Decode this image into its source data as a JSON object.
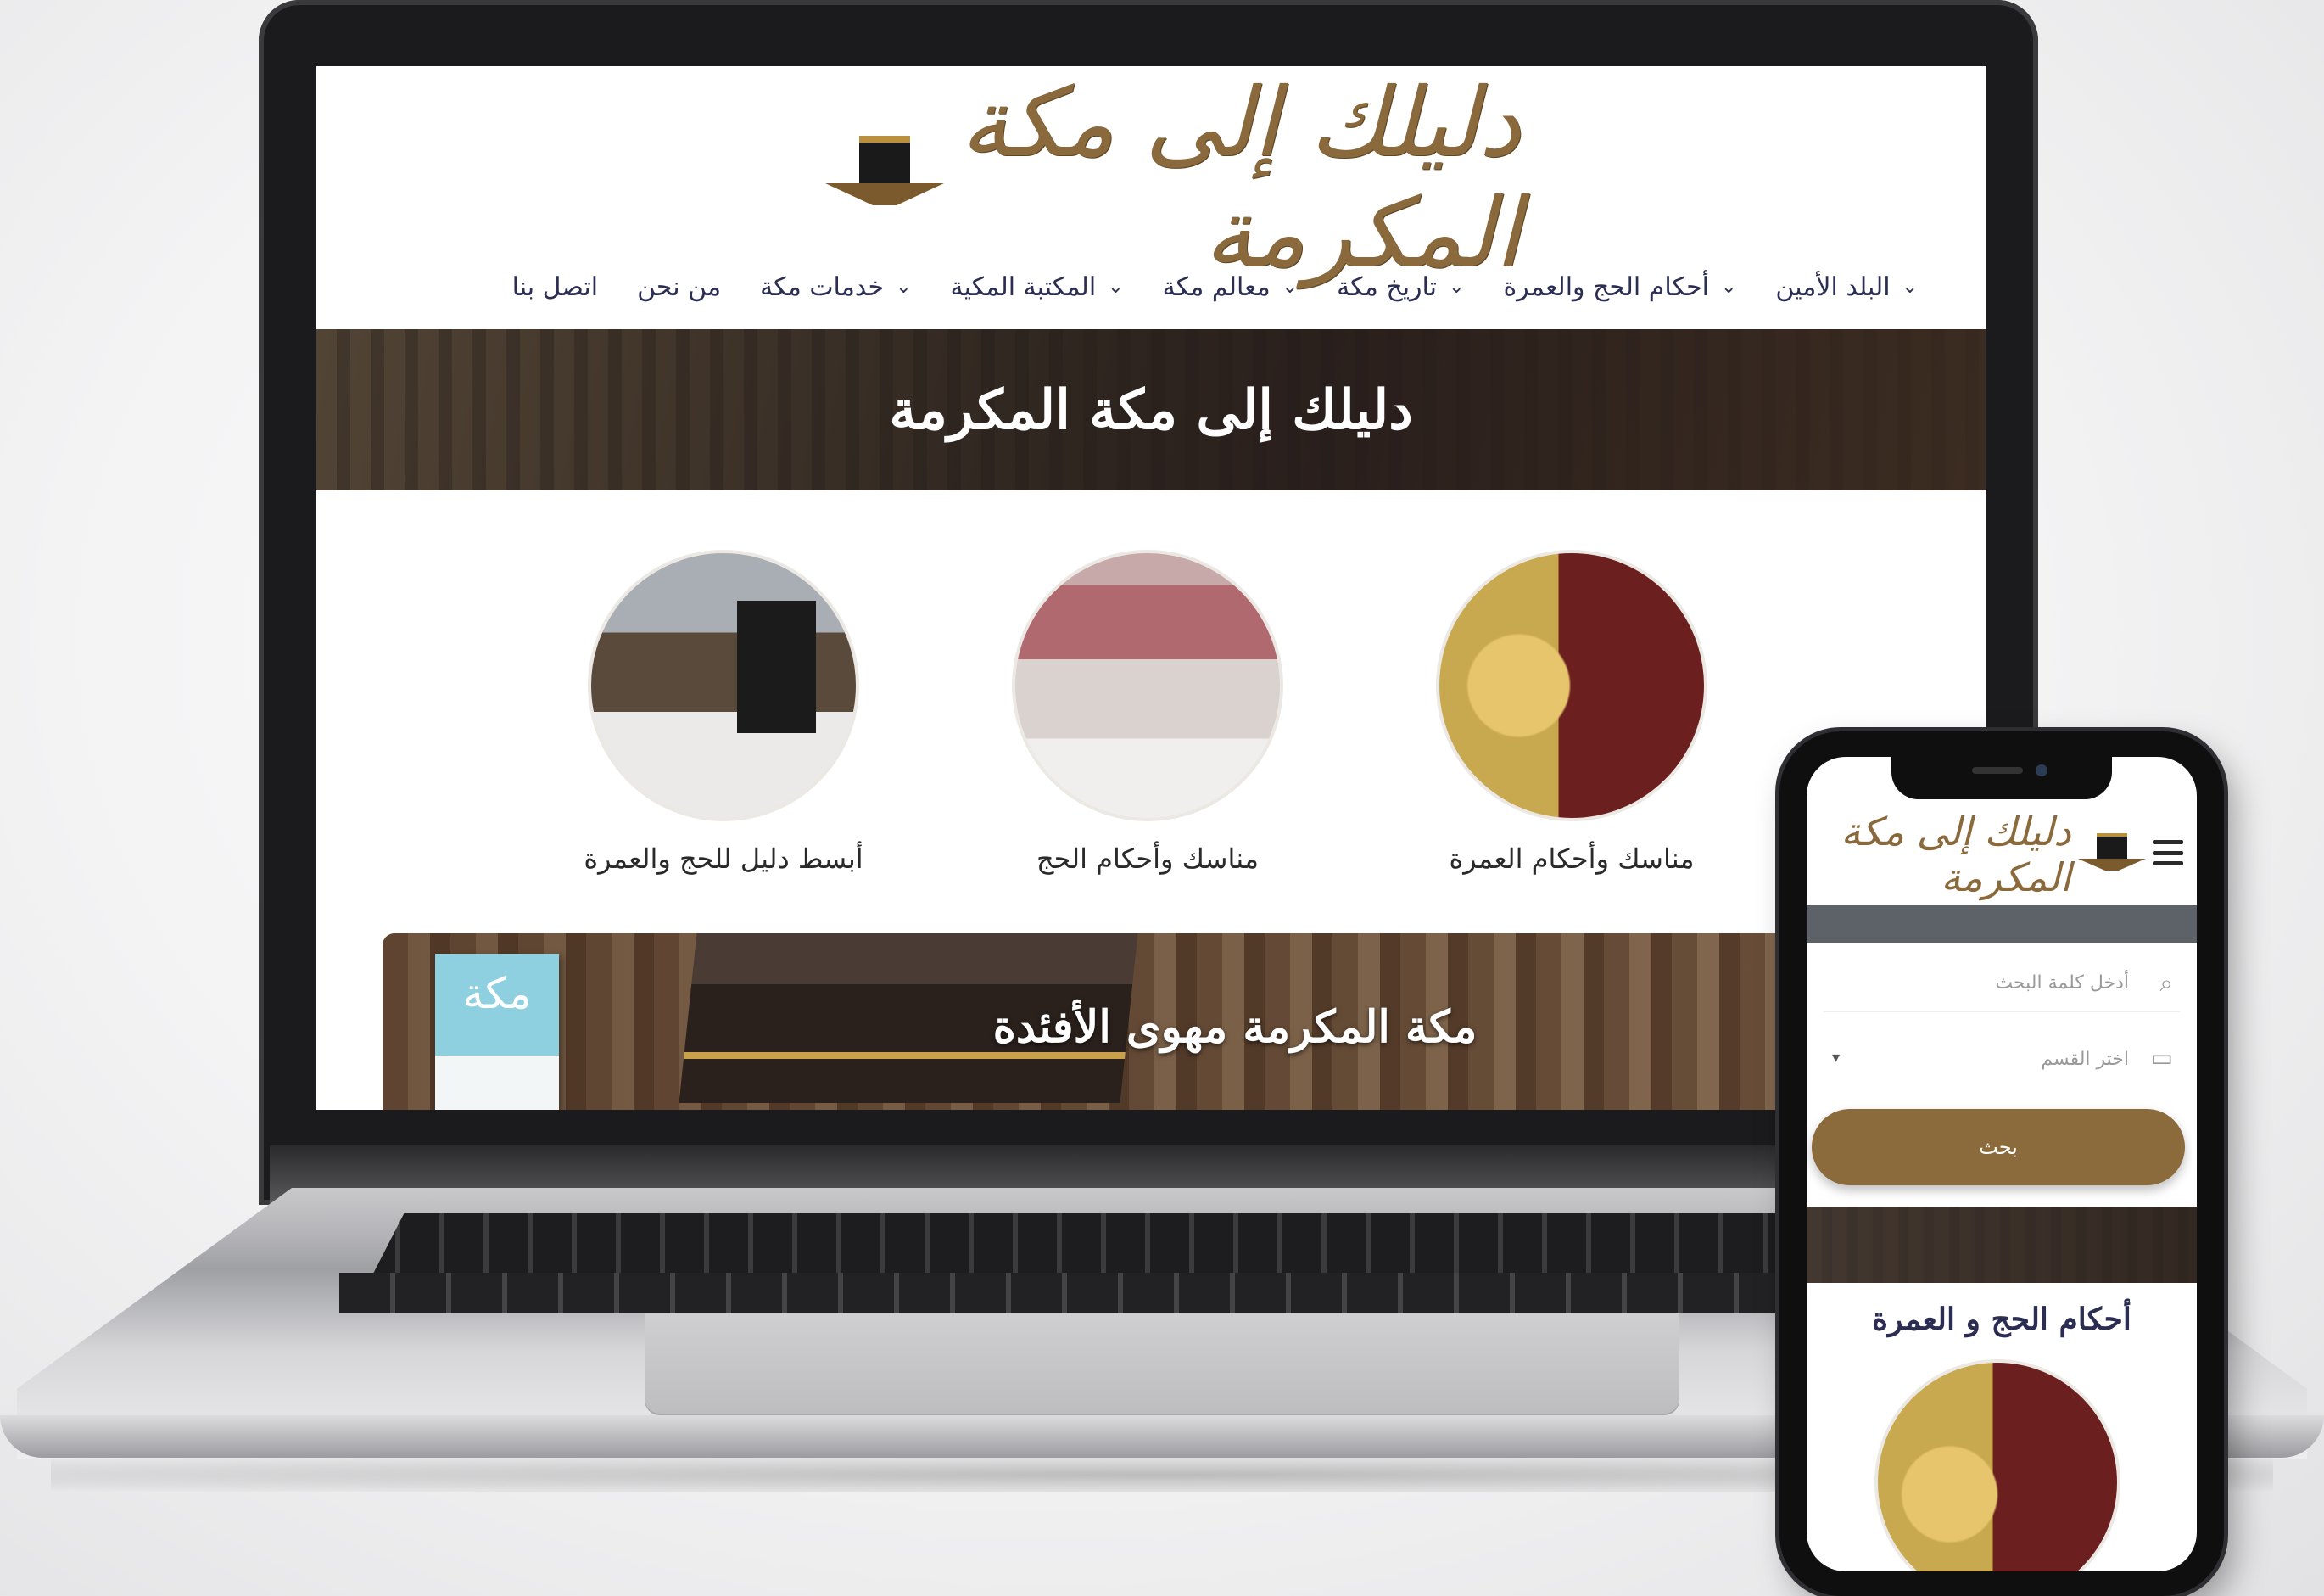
{
  "site": {
    "logo_text": "دليلك إلى مكة المكرمة",
    "brand_color": "#8b6a3b",
    "nav_color": "#2b2e52"
  },
  "nav": {
    "items": [
      {
        "label": "البلد الأمين",
        "has_dropdown": true
      },
      {
        "label": "أحكام الحج والعمرة",
        "has_dropdown": true
      },
      {
        "label": "تاريخ مكة",
        "has_dropdown": true
      },
      {
        "label": "معالم مكة",
        "has_dropdown": true
      },
      {
        "label": "المكتبة المكية",
        "has_dropdown": true
      },
      {
        "label": "خدمات مكة",
        "has_dropdown": true
      },
      {
        "label": "من نحن",
        "has_dropdown": false
      },
      {
        "label": "اتصل بنا",
        "has_dropdown": false
      }
    ],
    "chevron_icon": "chevron-down-icon"
  },
  "hero": {
    "title": "دليلك إلى مكة المكرمة"
  },
  "cards": [
    {
      "label": "مناسك وأحكام العمرة"
    },
    {
      "label": "مناسك وأحكام الحج"
    },
    {
      "label": "أبسط دليل للحج والعمرة"
    }
  ],
  "banner": {
    "title": "مكة المكرمة مهوى الأفئدة",
    "book_title": "مكة"
  },
  "phone": {
    "search_placeholder": "أدخل كلمة البحث",
    "select_placeholder": "اختر القسم",
    "search_button": "بحث",
    "section_title": "أحكام الحج و العمرة"
  }
}
